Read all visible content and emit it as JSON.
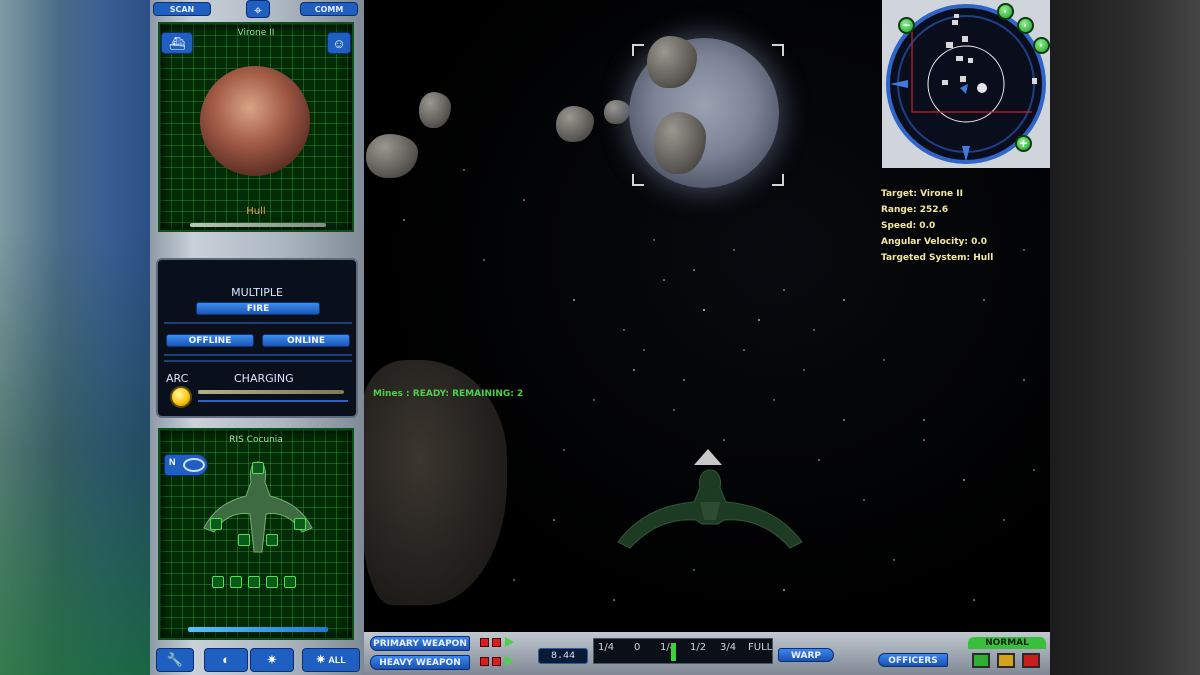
{
  "top_tabs": {
    "scan": "SCAN",
    "comm": "COMM"
  },
  "target_screen": {
    "title": "Virone II",
    "subsystem": "Hull"
  },
  "weapon_groups": [
    "power-icon",
    "helm-icon",
    "science-icon",
    "engineering-icon",
    "crew-icon",
    "weapons-icon"
  ],
  "fire_mode": {
    "label": "MULTIPLE",
    "fire_button": "FIRE"
  },
  "status_buttons": {
    "offline": "OFFLINE",
    "online": "ONLINE"
  },
  "arc": {
    "label": "ARC",
    "status": "CHARGING"
  },
  "own_ship": {
    "name": "RIS Cocunia",
    "indicator": "N"
  },
  "bottom_left_buttons": [
    "wrench-icon",
    "radar-icon",
    "burst-icon"
  ],
  "fire_all": {
    "label": "ALL"
  },
  "mines_status": "Mines : READY: REMAINING: 2",
  "weapons": {
    "primary": "PRIMARY WEAPON",
    "heavy": "HEAVY WEAPON"
  },
  "speed_value": "8.44",
  "throttle": {
    "marks": [
      "1/4",
      "0",
      "1/4",
      "1/2",
      "3/4",
      "FULL"
    ],
    "position_fraction": 0.25
  },
  "warp_button": "WARP",
  "officers_button": "OFFICERS",
  "alert": {
    "level": "NORMAL",
    "colors": [
      "#2fae2f",
      "#d3a41b",
      "#c81e1e"
    ]
  },
  "target_info": {
    "target": "Target: Virone II",
    "range": "Range: 252.6",
    "speed": "Speed: 0.0",
    "angular_velocity": "Angular Velocity: 0.0",
    "targeted_system": "Targeted System: Hull"
  }
}
